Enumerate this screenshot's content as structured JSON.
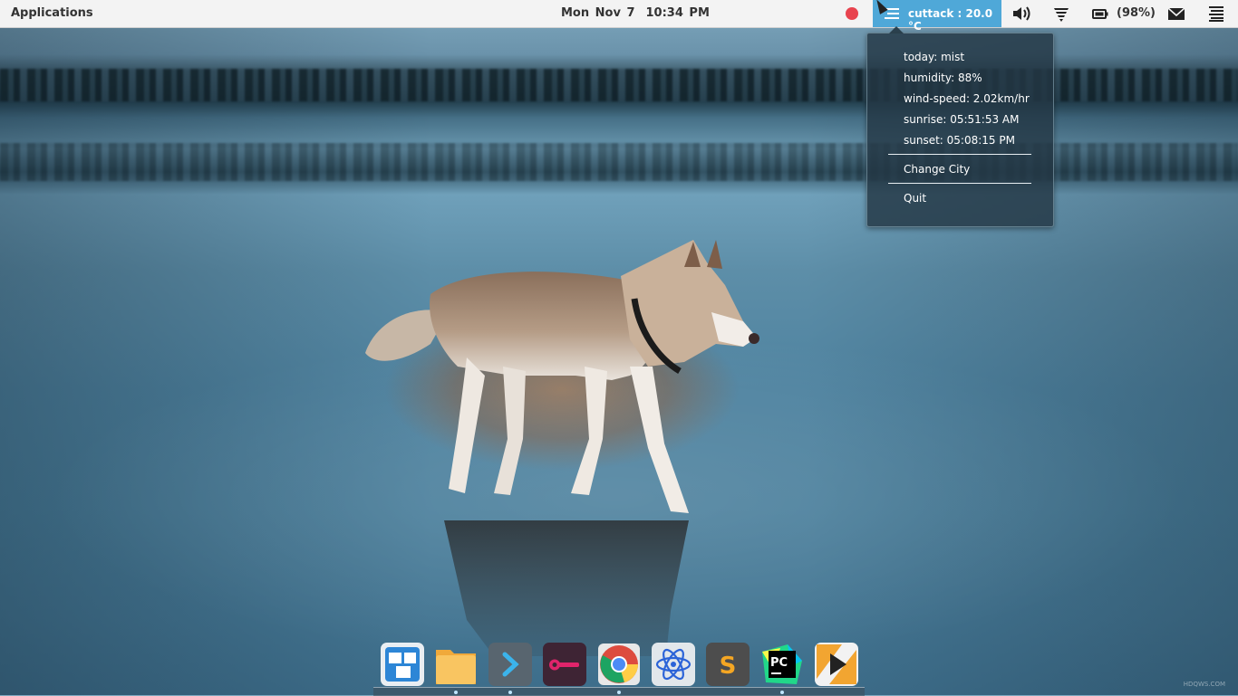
{
  "topbar": {
    "applications_label": "Applications",
    "date": "Mon Nov 7",
    "time": "10:34 PM",
    "record_color": "#e8434e",
    "weather_indicator": {
      "label": "cuttack : 20.0 °C",
      "icon": "mist-icon",
      "bg_color": "#4fa8d8"
    },
    "volume_icon": "speaker-icon",
    "network_icon": "wifi-icon",
    "battery": {
      "icon": "battery-icon",
      "label": "(98%)"
    },
    "mail_icon": "mail-icon",
    "menu_icon": "hamburger-icon"
  },
  "weather_popup": {
    "info": [
      "today: mist",
      "humidity: 88%",
      "wind-speed: 2.02km/hr",
      "sunrise: 05:51:53 AM",
      "sunset: 05:08:15 PM"
    ],
    "change_city_label": "Change City",
    "quit_label": "Quit"
  },
  "dock": {
    "items": [
      {
        "name": "multitasking-view-icon",
        "color": "#3b8ed8"
      },
      {
        "name": "files-icon",
        "color": "#f5b84a"
      },
      {
        "name": "terminal-icon",
        "color": "#5a6670"
      },
      {
        "name": "screen-recorder-icon",
        "color": "#4a2a3c"
      },
      {
        "name": "chrome-icon",
        "color": "#dd4b3e"
      },
      {
        "name": "atom-icon",
        "color": "#dfe5ea"
      },
      {
        "name": "sublime-text-icon",
        "color": "#4e4e4e"
      },
      {
        "name": "pycharm-icon",
        "color": "#21d789"
      },
      {
        "name": "media-player-icon",
        "color": "#f2a531"
      }
    ]
  },
  "watermark": "HDQWS.COM"
}
